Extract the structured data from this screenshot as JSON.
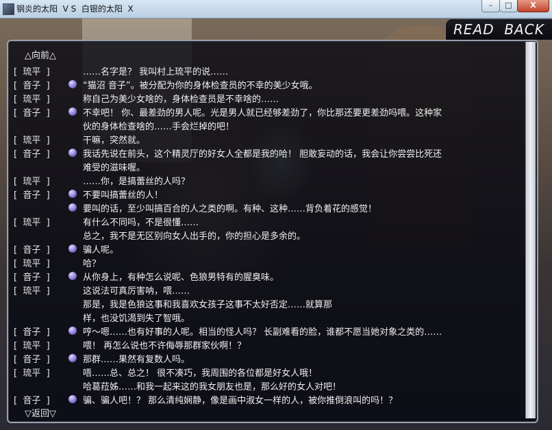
{
  "window": {
    "title": "钢炎的太阳  V S  白银的太阳  X",
    "min_glyph": "–",
    "max_glyph": "□",
    "close_glyph": "X"
  },
  "header": {
    "mode_label": "READ  BACK"
  },
  "nav": {
    "prev_label": "△向前△",
    "next_label": "▽返回▽"
  },
  "log": [
    {
      "speaker": "[  琉平  ]",
      "voice": false,
      "text": "……名字是？  我叫村上琉平的说……"
    },
    {
      "speaker": "[  音子  ]",
      "voice": true,
      "text": "“猫沼  音子”。被分配为你的身体检查员的不幸的美少女哦。"
    },
    {
      "speaker": "[  琉平  ]",
      "voice": false,
      "text": "称自己为美少女啥的，身体检查员是不幸啥的……"
    },
    {
      "speaker": "[  音子  ]",
      "voice": true,
      "text": "不幸吧！  你、最差劲的男人呢。光是男人就已经够差劲了，你比那还要更差劲吗喂。这种家"
    },
    {
      "speaker": "",
      "voice": false,
      "text": "伙的身体检查啥的……手会烂掉的吧！"
    },
    {
      "speaker": "[  琉平  ]",
      "voice": false,
      "text": "干嘛，突然就。"
    },
    {
      "speaker": "[  音子  ]",
      "voice": true,
      "text": "我话先说在前头，这个精灵厅的好女人全都是我的哈！   胆敢妄动的话，我会让你尝尝比死还"
    },
    {
      "speaker": "",
      "voice": false,
      "text": "难受的滋味喔。"
    },
    {
      "speaker": "[  琉平  ]",
      "voice": false,
      "text": "……你，是搞蕾丝的人吗？"
    },
    {
      "speaker": "[  音子  ]",
      "voice": true,
      "text": "不要叫搞蕾丝的人！"
    },
    {
      "speaker": "",
      "voice": true,
      "text": "要叫的话，至少叫搞百合的人之类的啊。有种、这种……背负着花的感觉！"
    },
    {
      "speaker": "[  琉平  ]",
      "voice": false,
      "text": "有什么不同吗，不是很懂……"
    },
    {
      "speaker": "",
      "voice": false,
      "text": "总之，我不是无区别向女人出手的，你的担心是多余的。"
    },
    {
      "speaker": "[  音子  ]",
      "voice": true,
      "text": "骗人呢。"
    },
    {
      "speaker": "[  琉平  ]",
      "voice": false,
      "text": "哈？"
    },
    {
      "speaker": "[  音子  ]",
      "voice": true,
      "text": "从你身上，有种怎么说呢、色狼男特有的腥臭味。"
    },
    {
      "speaker": "[  琉平  ]",
      "voice": false,
      "text": "这说法可真厉害呐，喂……"
    },
    {
      "speaker": "",
      "voice": false,
      "text": "那是，我是色狼这事和我喜欢女孩子这事不太好否定……就算那"
    },
    {
      "speaker": "",
      "voice": false,
      "text": "样，也没饥渴到失了智哦。"
    },
    {
      "speaker": "[  音子  ]",
      "voice": true,
      "text": "哼〜嗯……也有好事的人呢。相当的怪人吗？   长副难看的脸，谁都不愿当她对象之类的……"
    },
    {
      "speaker": "[  琉平  ]",
      "voice": false,
      "text": "喂！   再怎么说也不许侮辱那群家伙啊！？"
    },
    {
      "speaker": "[  音子  ]",
      "voice": true,
      "text": "那群……果然有复数人吗。"
    },
    {
      "speaker": "[  琉平  ]",
      "voice": false,
      "text": "唔……总、总之！   很不凑巧，我周围的各位都是好女人哦！"
    },
    {
      "speaker": "",
      "voice": false,
      "text": "哈葛菈姊……和我一起来这的我女朋友也是，那么好的女人对吧！"
    },
    {
      "speaker": "[  音子  ]",
      "voice": true,
      "text": "骗、骗人吧！？   那么清纯娴静，像是画中淑女一样的人，被你推倒浪叫的吗！？"
    }
  ]
}
